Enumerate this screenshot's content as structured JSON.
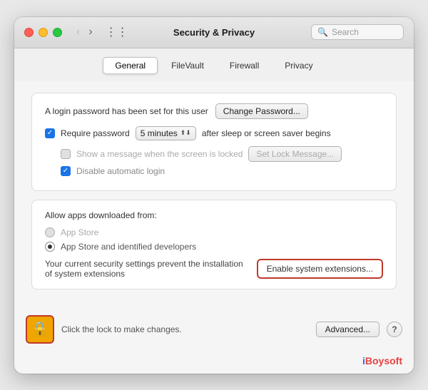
{
  "window": {
    "title": "Security & Privacy"
  },
  "titlebar": {
    "back_disabled": true,
    "forward_disabled": false,
    "search_placeholder": "Search"
  },
  "tabs": [
    {
      "label": "General",
      "active": true
    },
    {
      "label": "FileVault",
      "active": false
    },
    {
      "label": "Firewall",
      "active": false
    },
    {
      "label": "Privacy",
      "active": false
    }
  ],
  "general": {
    "login_password_text": "A login password has been set for this user",
    "change_password_label": "Change Password...",
    "require_password_label": "Require password",
    "require_password_dropdown": "5 minutes",
    "after_sleep_text": "after sleep or screen saver begins",
    "show_message_label": "Show a message when the screen is locked",
    "set_lock_message_label": "Set Lock Message...",
    "disable_auto_login_label": "Disable automatic login",
    "allow_apps_title": "Allow apps downloaded from:",
    "radio_app_store": "App Store",
    "radio_app_store_identified": "App Store and identified developers",
    "ext_warning_text": "Your current security settings prevent the installation of system extensions",
    "enable_ext_label": "Enable system extensions...",
    "lock_text": "Click the lock to make changes.",
    "advanced_label": "Advanced...",
    "help_label": "?"
  },
  "brand": {
    "i": "i",
    "boysoft": "Boysoft"
  }
}
